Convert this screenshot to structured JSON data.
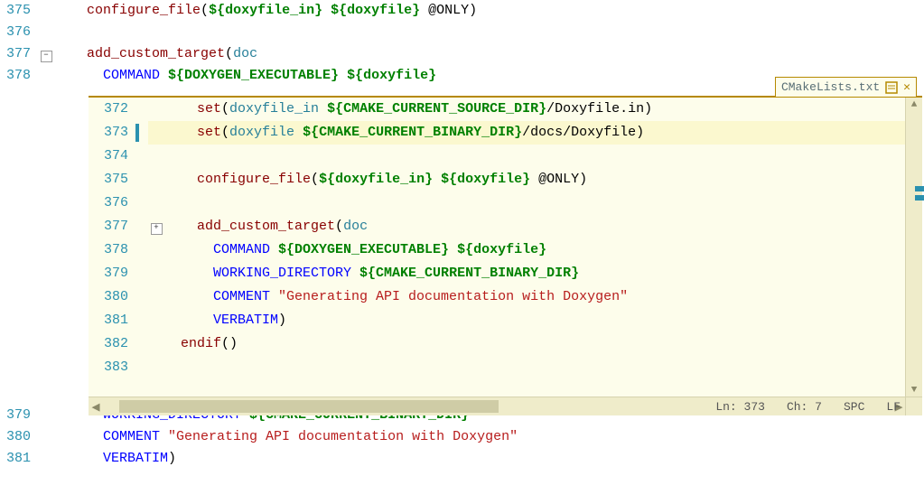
{
  "bg": {
    "lines": [
      {
        "n": 375,
        "fold": "",
        "indent": "    ",
        "tokens": [
          {
            "t": "configure_file",
            "c": "tok-fn"
          },
          {
            "t": "(",
            "c": "tok-punc"
          },
          {
            "t": "${doxyfile_in}",
            "c": "tok-ref"
          },
          {
            "t": " ",
            "c": ""
          },
          {
            "t": "${doxyfile}",
            "c": "tok-ref"
          },
          {
            "t": " @ONLY)",
            "c": "tok-punc"
          }
        ]
      },
      {
        "n": 376,
        "fold": "",
        "indent": "",
        "tokens": []
      },
      {
        "n": 377,
        "fold": "-",
        "indent": "    ",
        "tokens": [
          {
            "t": "add_custom_target",
            "c": "tok-fn"
          },
          {
            "t": "(",
            "c": "tok-punc"
          },
          {
            "t": "doc",
            "c": "tok-var"
          }
        ]
      },
      {
        "n": 378,
        "fold": "",
        "indent": "      ",
        "tokens": [
          {
            "t": "COMMAND ",
            "c": "tok-kw"
          },
          {
            "t": "${DOXYGEN_EXECUTABLE}",
            "c": "tok-ref"
          },
          {
            "t": " ",
            "c": ""
          },
          {
            "t": "${doxyfile}",
            "c": "tok-ref"
          }
        ]
      }
    ],
    "lines_after": [
      {
        "n": 379,
        "fold": "",
        "indent": "      ",
        "tokens": [
          {
            "t": "WORKING_DIRECTORY ",
            "c": "tok-kw"
          },
          {
            "t": "${CMAKE_CURRENT_BINARY_DIR}",
            "c": "tok-ref"
          }
        ]
      },
      {
        "n": 380,
        "fold": "",
        "indent": "      ",
        "tokens": [
          {
            "t": "COMMENT ",
            "c": "tok-kw"
          },
          {
            "t": "\"Generating API documentation with Doxygen\"",
            "c": "tok-str"
          }
        ]
      },
      {
        "n": 381,
        "fold": "",
        "indent": "      ",
        "tokens": [
          {
            "t": "VERBATIM",
            "c": "tok-kw"
          },
          {
            "t": ")",
            "c": "tok-punc"
          }
        ]
      }
    ]
  },
  "peek": {
    "tab_title": "CMakeLists.txt",
    "status": {
      "ln_label": "Ln:",
      "ln": "373",
      "ch_label": "Ch:",
      "ch": "7",
      "enc": "SPC",
      "eol": "LF"
    },
    "lines": [
      {
        "n": 372,
        "mark": "",
        "fold": "",
        "indent": "    ",
        "tokens": [
          {
            "t": "set",
            "c": "tok-fn"
          },
          {
            "t": "(",
            "c": "tok-punc"
          },
          {
            "t": "doxyfile_in ",
            "c": "tok-var"
          },
          {
            "t": "${CMAKE_CURRENT_SOURCE_DIR}",
            "c": "tok-ref"
          },
          {
            "t": "/Doxyfile.in)",
            "c": "tok-punc"
          }
        ]
      },
      {
        "n": 373,
        "mark": "|",
        "fold": "",
        "cursor": true,
        "indent": "    ",
        "tokens": [
          {
            "t": "set",
            "c": "tok-fn"
          },
          {
            "t": "(",
            "c": "tok-punc"
          },
          {
            "t": "doxyfile ",
            "c": "tok-var"
          },
          {
            "t": "${CMAKE_CURRENT_BINARY_DIR}",
            "c": "tok-ref"
          },
          {
            "t": "/docs/Doxyfile)",
            "c": "tok-punc"
          }
        ]
      },
      {
        "n": 374,
        "mark": "",
        "fold": "",
        "indent": "",
        "tokens": []
      },
      {
        "n": 375,
        "mark": "",
        "fold": "",
        "indent": "    ",
        "tokens": [
          {
            "t": "configure_file",
            "c": "tok-fn"
          },
          {
            "t": "(",
            "c": "tok-punc"
          },
          {
            "t": "${doxyfile_in}",
            "c": "tok-ref"
          },
          {
            "t": " ",
            "c": ""
          },
          {
            "t": "${doxyfile}",
            "c": "tok-ref"
          },
          {
            "t": " @ONLY)",
            "c": "tok-punc"
          }
        ]
      },
      {
        "n": 376,
        "mark": "",
        "fold": "",
        "indent": "",
        "tokens": []
      },
      {
        "n": 377,
        "mark": "",
        "fold": "+",
        "indent": "    ",
        "tokens": [
          {
            "t": "add_custom_target",
            "c": "tok-fn"
          },
          {
            "t": "(",
            "c": "tok-punc"
          },
          {
            "t": "doc",
            "c": "tok-var"
          }
        ]
      },
      {
        "n": 378,
        "mark": "",
        "fold": "",
        "indent": "      ",
        "tokens": [
          {
            "t": "COMMAND ",
            "c": "tok-kw"
          },
          {
            "t": "${DOXYGEN_EXECUTABLE}",
            "c": "tok-ref"
          },
          {
            "t": " ",
            "c": ""
          },
          {
            "t": "${doxyfile}",
            "c": "tok-ref"
          }
        ]
      },
      {
        "n": 379,
        "mark": "",
        "fold": "",
        "indent": "      ",
        "tokens": [
          {
            "t": "WORKING_DIRECTORY ",
            "c": "tok-kw"
          },
          {
            "t": "${CMAKE_CURRENT_BINARY_DIR}",
            "c": "tok-ref"
          }
        ]
      },
      {
        "n": 380,
        "mark": "",
        "fold": "",
        "indent": "      ",
        "tokens": [
          {
            "t": "COMMENT ",
            "c": "tok-kw"
          },
          {
            "t": "\"Generating API documentation with Doxygen\"",
            "c": "tok-str"
          }
        ]
      },
      {
        "n": 381,
        "mark": "",
        "fold": "",
        "indent": "      ",
        "tokens": [
          {
            "t": "VERBATIM",
            "c": "tok-kw"
          },
          {
            "t": ")",
            "c": "tok-punc"
          }
        ]
      },
      {
        "n": 382,
        "mark": "",
        "fold": "",
        "indent": "  ",
        "tokens": [
          {
            "t": "endif",
            "c": "tok-fn"
          },
          {
            "t": "()",
            "c": "tok-punc"
          }
        ]
      },
      {
        "n": 383,
        "mark": "",
        "fold": "",
        "indent": "",
        "tokens": []
      }
    ]
  }
}
